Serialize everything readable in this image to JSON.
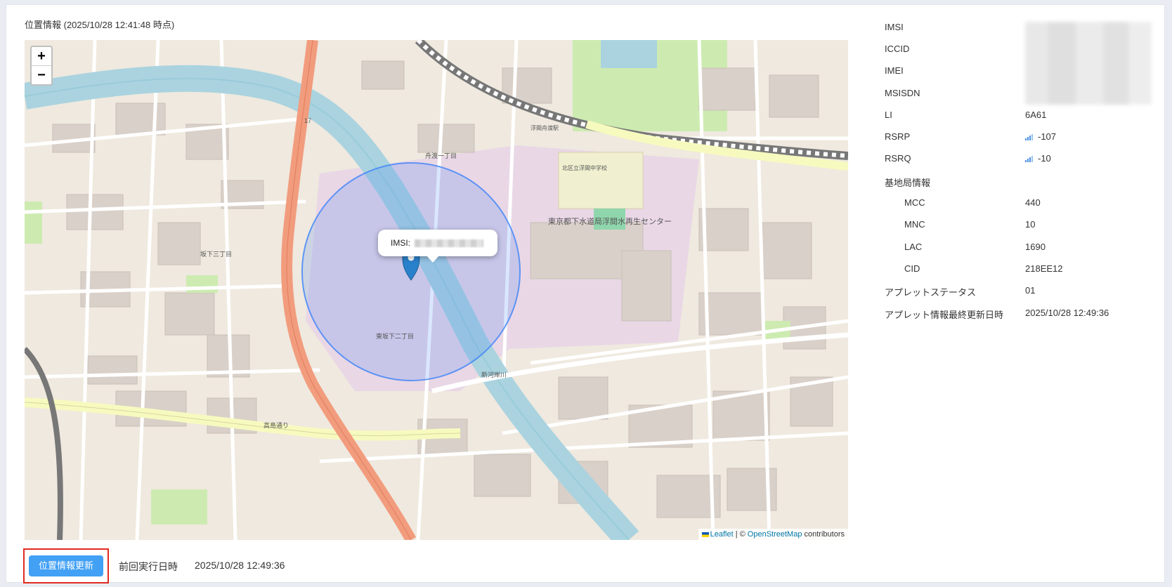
{
  "map": {
    "title": "位置情報 (2025/10/28 12:41:48 時点)",
    "zoom_in": "+",
    "zoom_out": "−",
    "popup_label": "IMSI:",
    "attribution": {
      "leaflet": "Leaflet",
      "sep": "| ©",
      "osm": "OpenStreetMap",
      "contributors": "contributors"
    },
    "labels": {
      "center_facility": "東京都下水道局浮間水再生センター",
      "area": "東坂下二丁目",
      "road": "高島通り",
      "route": "17",
      "river": "新河岸川",
      "station": "浮間舟渡駅",
      "school": "北区立浮間中学校",
      "street2": "坂下三丁目",
      "town": "舟渡一丁目"
    }
  },
  "info": {
    "imsi_label": "IMSI",
    "iccid_label": "ICCID",
    "imei_label": "IMEI",
    "msisdn_label": "MSISDN",
    "li_label": "LI",
    "li_value": "6A61",
    "rsrp_label": "RSRP",
    "rsrp_value": "-107",
    "rsrq_label": "RSRQ",
    "rsrq_value": "-10",
    "base_station_label": "基地局情報",
    "mcc_label": "MCC",
    "mcc_value": "440",
    "mnc_label": "MNC",
    "mnc_value": "10",
    "lac_label": "LAC",
    "lac_value": "1690",
    "cid_label": "CID",
    "cid_value": "218EE12",
    "applet_status_label": "アプレットステータス",
    "applet_status_value": "01",
    "applet_updated_label": "アプレット情報最終更新日時",
    "applet_updated_value": "2025/10/28 12:49:36"
  },
  "footer": {
    "update_button": "位置情報更新",
    "prev_exec_label": "前回実行日時",
    "prev_exec_value": "2025/10/28 12:49:36"
  },
  "colors": {
    "button": "#42a0f5",
    "highlight": "#e02a1f",
    "circle": "#3f83f7",
    "marker": "#2a81cb",
    "road_main": "#f29c7e",
    "river": "#aad3df"
  }
}
